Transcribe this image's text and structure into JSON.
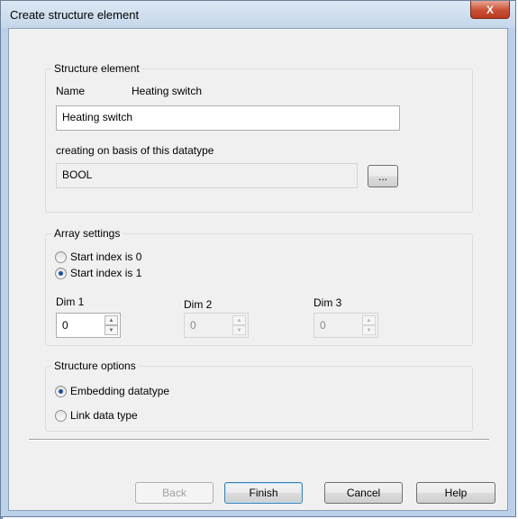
{
  "window": {
    "title": "Create structure element",
    "close_glyph": "X"
  },
  "structure_element": {
    "legend": "Structure element",
    "name_label": "Name",
    "name_value": "Heating switch",
    "name_input": "Heating switch",
    "datatype_label": "creating on basis of this datatype",
    "datatype_value": "BOOL",
    "browse_label": "..."
  },
  "array_settings": {
    "legend": "Array settings",
    "start0_label": "Start index is 0",
    "start0_selected": false,
    "start1_label": "Start index is 1",
    "start1_selected": true,
    "dims": [
      {
        "label": "Dim 1",
        "value": "0",
        "enabled": true
      },
      {
        "label": "Dim 2",
        "value": "0",
        "enabled": false
      },
      {
        "label": "Dim 3",
        "value": "0",
        "enabled": false
      }
    ]
  },
  "structure_options": {
    "legend": "Structure options",
    "embedding_label": "Embedding datatype",
    "embedding_selected": true,
    "link_label": "Link data type",
    "link_selected": false
  },
  "buttons": {
    "back": "Back",
    "finish": "Finish",
    "cancel": "Cancel",
    "help": "Help"
  },
  "icons": {
    "spin_up": "▲",
    "spin_down": "▼"
  }
}
